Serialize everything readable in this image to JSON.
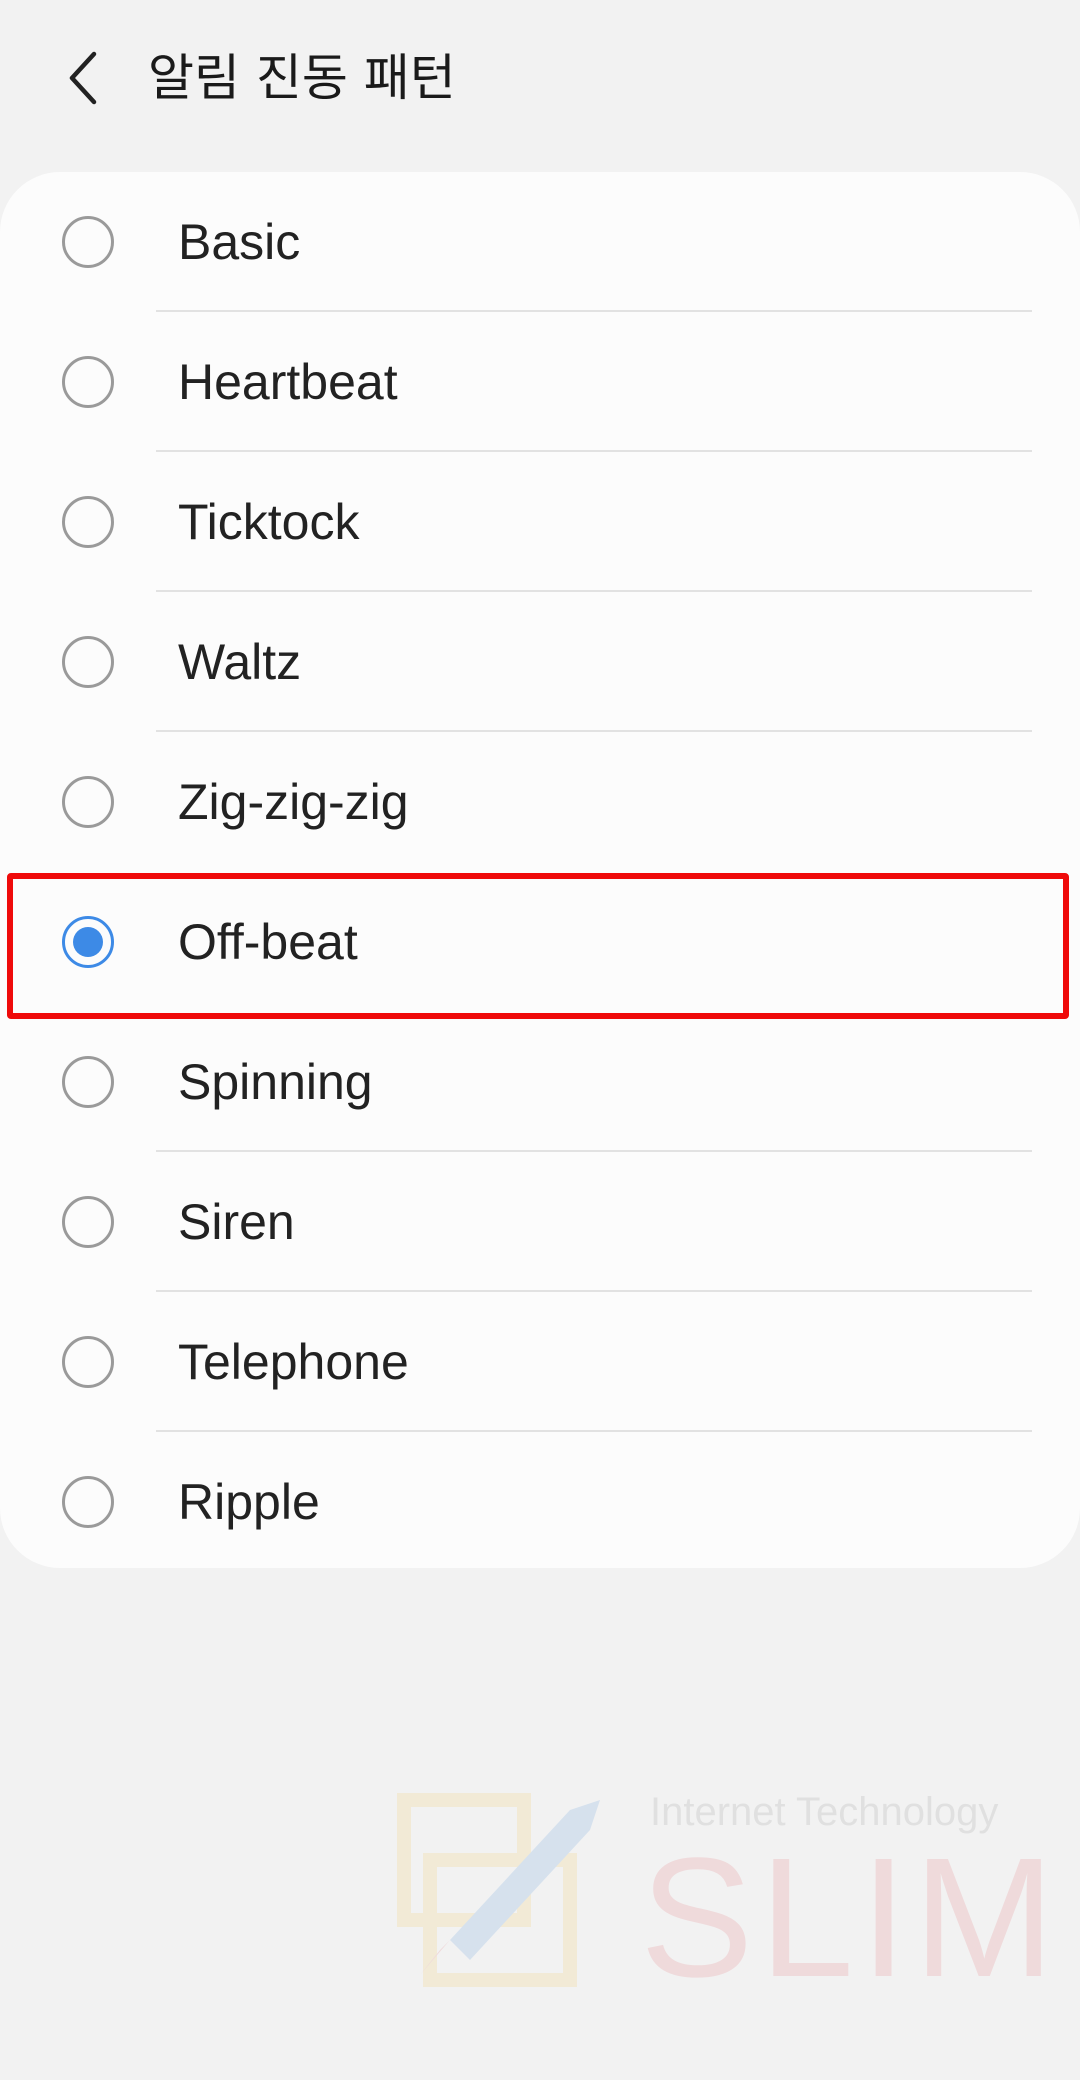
{
  "header": {
    "back_icon": "chevron-left-icon",
    "title": "알림 진동 패턴"
  },
  "options": [
    {
      "label": "Basic",
      "selected": false
    },
    {
      "label": "Heartbeat",
      "selected": false
    },
    {
      "label": "Ticktock",
      "selected": false
    },
    {
      "label": "Waltz",
      "selected": false
    },
    {
      "label": "Zig-zig-zig",
      "selected": false
    },
    {
      "label": "Off-beat",
      "selected": true
    },
    {
      "label": "Spinning",
      "selected": false
    },
    {
      "label": "Siren",
      "selected": false
    },
    {
      "label": "Telephone",
      "selected": false
    },
    {
      "label": "Ripple",
      "selected": false
    }
  ],
  "highlight": {
    "target": "Off-beat",
    "color": "#ef0a0a"
  },
  "colors": {
    "accent": "#3d8ae6",
    "background": "#f2f2f2",
    "card": "#fcfcfc"
  },
  "watermark": {
    "subtitle": "Internet Technology",
    "brand": "SLIM"
  }
}
